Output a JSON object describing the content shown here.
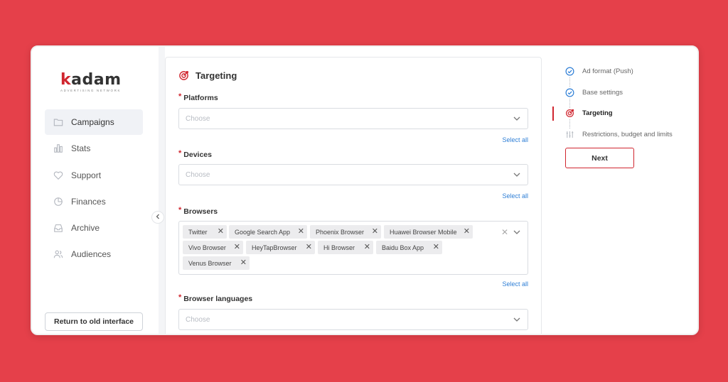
{
  "logo": {
    "main_k": "k",
    "main_rest": "adam",
    "sub": "advertising network"
  },
  "sidebar": {
    "items": [
      {
        "label": "Campaigns",
        "icon": "folder-icon",
        "active": true
      },
      {
        "label": "Stats",
        "icon": "bar-chart-icon",
        "active": false
      },
      {
        "label": "Support",
        "icon": "heart-icon",
        "active": false
      },
      {
        "label": "Finances",
        "icon": "pie-chart-icon",
        "active": false
      },
      {
        "label": "Archive",
        "icon": "inbox-icon",
        "active": false
      },
      {
        "label": "Audiences",
        "icon": "users-icon",
        "active": false
      }
    ],
    "return_label": "Return to old interface"
  },
  "main": {
    "title": "Targeting",
    "fields": {
      "platforms": {
        "label": "Platforms",
        "placeholder": "Choose",
        "select_all": "Select all"
      },
      "devices": {
        "label": "Devices",
        "placeholder": "Choose",
        "select_all": "Select all"
      },
      "browsers": {
        "label": "Browsers",
        "select_all": "Select all",
        "tags": [
          "Twitter",
          "Google Search App",
          "Phoenix Browser",
          "Huawei Browser Mobile",
          "Vivo Browser",
          "HeyTapBrowser",
          "Hi Browser",
          "Baidu Box App",
          "Venus Browser"
        ]
      },
      "languages": {
        "label": "Browser languages",
        "placeholder": "Choose"
      }
    }
  },
  "steps": [
    {
      "label": "Ad format (Push)",
      "state": "done"
    },
    {
      "label": "Base settings",
      "state": "done"
    },
    {
      "label": "Targeting",
      "state": "active"
    },
    {
      "label": "Restrictions, budget and limits",
      "state": "pending"
    }
  ],
  "next_label": "Next",
  "colors": {
    "background": "#e5404a",
    "accent": "#d0262f",
    "link": "#2f7fd6",
    "step_done": "#2f7fd6"
  }
}
